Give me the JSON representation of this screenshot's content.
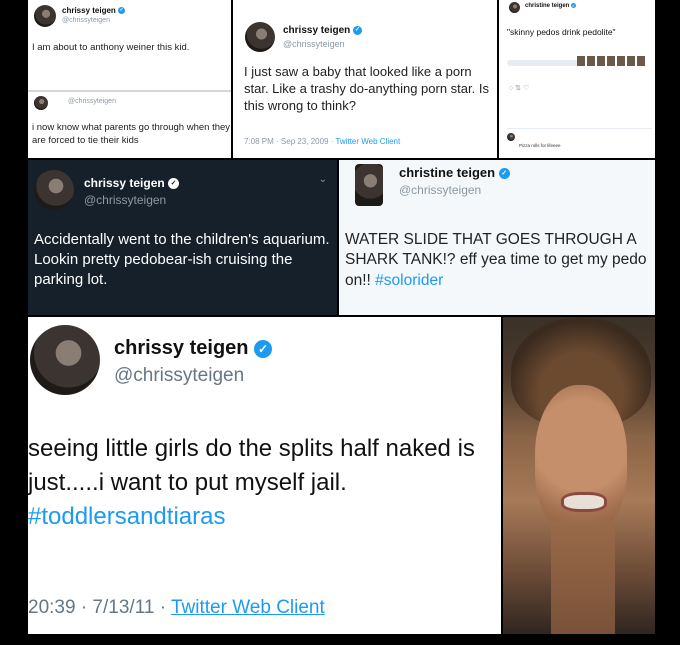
{
  "tweet1": {
    "name": "chrissy teigen",
    "handle": "@chrissyteigen",
    "text": "I am about to anthony weiner this kid."
  },
  "tweet2": {
    "handle": "@chrissyteigen",
    "text": "i now know what parents go through when they are forced to tie their kids"
  },
  "tweet3": {
    "name": "chrissy teigen",
    "handle": "@chrissyteigen",
    "text": "I just saw a baby that looked like a porn star. Like a trashy do-anything porn star. Is this wrong to think?",
    "time": "7:08 PM · Sep 23, 2009 · ",
    "client": "Twitter Web Client"
  },
  "tweet4": {
    "name": "christine teigen",
    "text": "\"skinny pedos drink pedolite\"",
    "snippet": "Pizza rolls for lifeeee"
  },
  "tweet5": {
    "name": "chrissy teigen",
    "handle": "@chrissyteigen",
    "text": "Accidentally went to the children's aquarium. Lookin pretty pedobear-ish cruising the parking lot."
  },
  "tweet6": {
    "name": "christine teigen",
    "handle": "@chrissyteigen",
    "text": "WATER SLIDE THAT GOES THROUGH A SHARK TANK!? eff yea time to get my pedo on!! ",
    "hashtag": "#solorider"
  },
  "tweet7": {
    "name": "chrissy teigen",
    "handle": "@chrissyteigen",
    "text": "seeing little girls do the splits half naked is just.....i want to put myself jail. ",
    "hashtag": "#toddlersandtiaras",
    "time": "20:39 · 7/13/11 · ",
    "client": "Twitter Web Client"
  },
  "colors": {
    "link": "#1d9bf0",
    "dark_bg": "#15202b",
    "light_bg": "#ffffff",
    "light_blue_bg": "#f5f8fa"
  },
  "icons": {
    "verified": "verified-badge-icon",
    "chevron": "chevron-down-icon"
  }
}
